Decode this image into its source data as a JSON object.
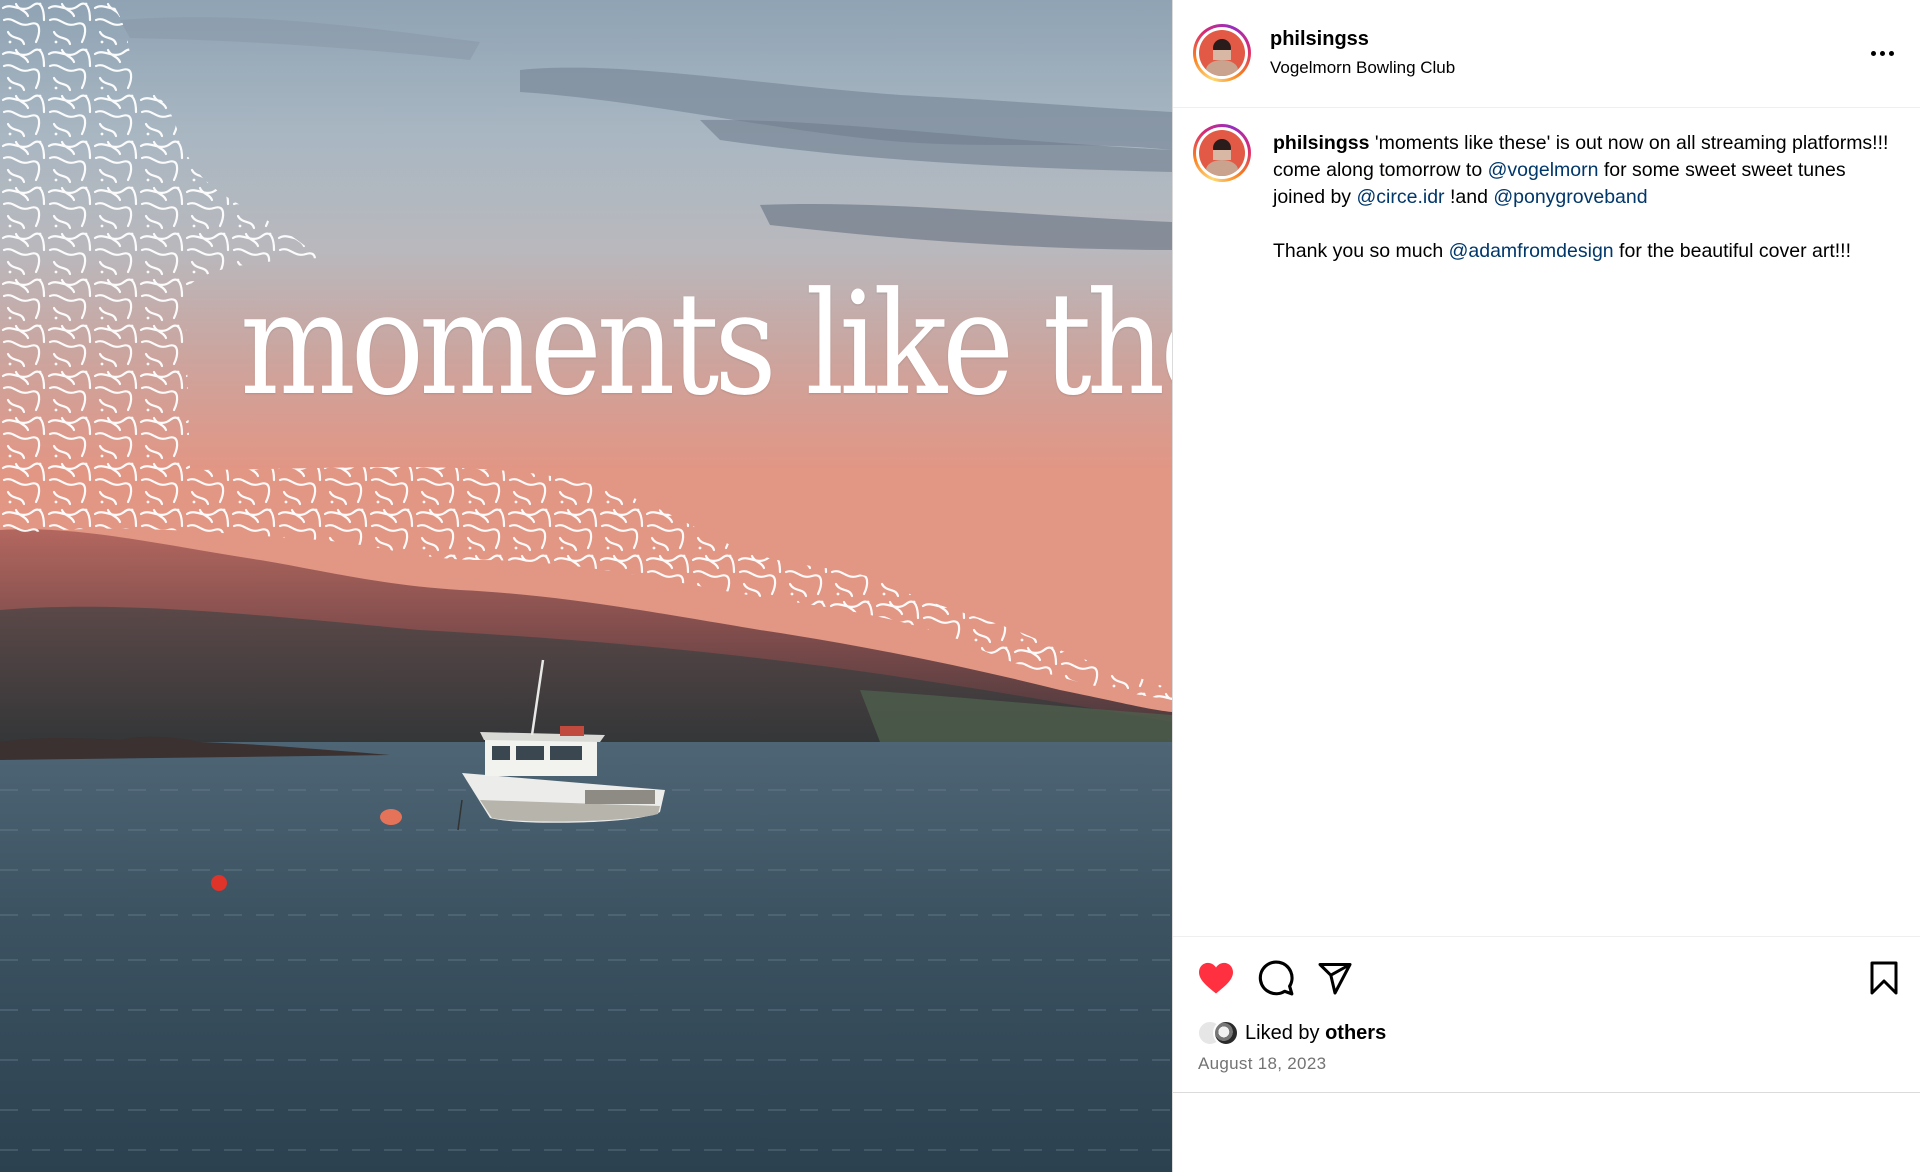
{
  "post": {
    "username": "philsingss",
    "location": "Vogelmorn Bowling Club",
    "more_icon": "more-horizontal-icon"
  },
  "media": {
    "cover_text": "moments like these",
    "scene": "sunset harbour with moored fishing boat, hills and white maze-line artwork"
  },
  "caption": {
    "username": "philsingss",
    "seg1": " 'moments like these' is out now on all streaming platforms!!!",
    "seg2": "come along tomorrow to ",
    "mention1": "@vogelmorn",
    "seg3": " for some sweet sweet tunes joined by ",
    "mention2": "@circe.idr",
    "seg4": " !and ",
    "mention3": "@ponygroveband",
    "seg5": "Thank you so much ",
    "mention4": "@adamfromdesign",
    "seg6": " for the beautiful cover art!!!"
  },
  "actions": {
    "liked": true,
    "like_color": "#ff3040",
    "icons": [
      "heart-icon",
      "comment-icon",
      "share-icon",
      "bookmark-icon"
    ]
  },
  "likes": {
    "prefix": "Liked by ",
    "who": "others"
  },
  "date": "August 18, 2023",
  "colors": {
    "mention": "#00376b",
    "secondary_text": "#737373",
    "divider": "#dbdbdb"
  }
}
